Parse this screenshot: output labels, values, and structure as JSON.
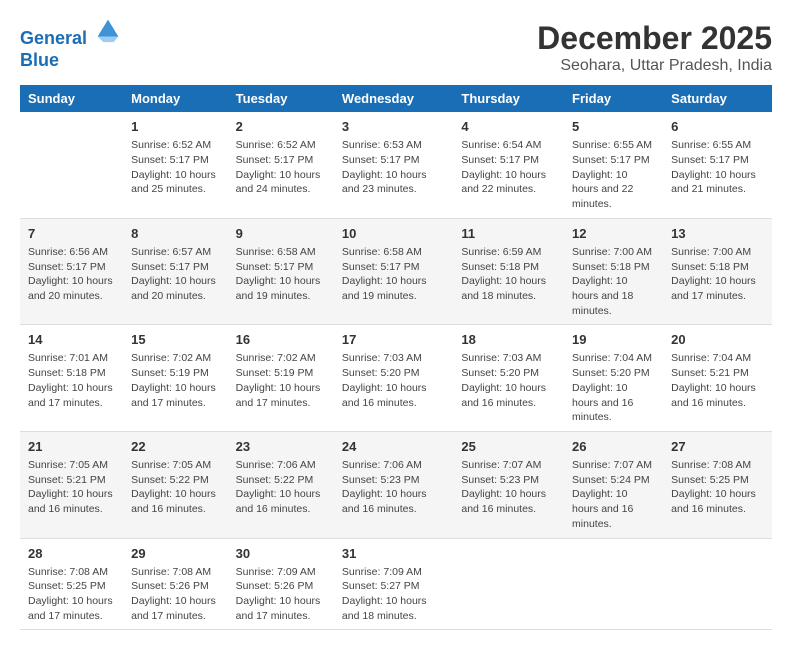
{
  "logo": {
    "line1": "General",
    "line2": "Blue"
  },
  "title": "December 2025",
  "subtitle": "Seohara, Uttar Pradesh, India",
  "headers": [
    "Sunday",
    "Monday",
    "Tuesday",
    "Wednesday",
    "Thursday",
    "Friday",
    "Saturday"
  ],
  "weeks": [
    [
      {
        "day": "",
        "sunrise": "",
        "sunset": "",
        "daylight": ""
      },
      {
        "day": "1",
        "sunrise": "Sunrise: 6:52 AM",
        "sunset": "Sunset: 5:17 PM",
        "daylight": "Daylight: 10 hours and 25 minutes."
      },
      {
        "day": "2",
        "sunrise": "Sunrise: 6:52 AM",
        "sunset": "Sunset: 5:17 PM",
        "daylight": "Daylight: 10 hours and 24 minutes."
      },
      {
        "day": "3",
        "sunrise": "Sunrise: 6:53 AM",
        "sunset": "Sunset: 5:17 PM",
        "daylight": "Daylight: 10 hours and 23 minutes."
      },
      {
        "day": "4",
        "sunrise": "Sunrise: 6:54 AM",
        "sunset": "Sunset: 5:17 PM",
        "daylight": "Daylight: 10 hours and 22 minutes."
      },
      {
        "day": "5",
        "sunrise": "Sunrise: 6:55 AM",
        "sunset": "Sunset: 5:17 PM",
        "daylight": "Daylight: 10 hours and 22 minutes."
      },
      {
        "day": "6",
        "sunrise": "Sunrise: 6:55 AM",
        "sunset": "Sunset: 5:17 PM",
        "daylight": "Daylight: 10 hours and 21 minutes."
      }
    ],
    [
      {
        "day": "7",
        "sunrise": "Sunrise: 6:56 AM",
        "sunset": "Sunset: 5:17 PM",
        "daylight": "Daylight: 10 hours and 20 minutes."
      },
      {
        "day": "8",
        "sunrise": "Sunrise: 6:57 AM",
        "sunset": "Sunset: 5:17 PM",
        "daylight": "Daylight: 10 hours and 20 minutes."
      },
      {
        "day": "9",
        "sunrise": "Sunrise: 6:58 AM",
        "sunset": "Sunset: 5:17 PM",
        "daylight": "Daylight: 10 hours and 19 minutes."
      },
      {
        "day": "10",
        "sunrise": "Sunrise: 6:58 AM",
        "sunset": "Sunset: 5:17 PM",
        "daylight": "Daylight: 10 hours and 19 minutes."
      },
      {
        "day": "11",
        "sunrise": "Sunrise: 6:59 AM",
        "sunset": "Sunset: 5:18 PM",
        "daylight": "Daylight: 10 hours and 18 minutes."
      },
      {
        "day": "12",
        "sunrise": "Sunrise: 7:00 AM",
        "sunset": "Sunset: 5:18 PM",
        "daylight": "Daylight: 10 hours and 18 minutes."
      },
      {
        "day": "13",
        "sunrise": "Sunrise: 7:00 AM",
        "sunset": "Sunset: 5:18 PM",
        "daylight": "Daylight: 10 hours and 17 minutes."
      }
    ],
    [
      {
        "day": "14",
        "sunrise": "Sunrise: 7:01 AM",
        "sunset": "Sunset: 5:18 PM",
        "daylight": "Daylight: 10 hours and 17 minutes."
      },
      {
        "day": "15",
        "sunrise": "Sunrise: 7:02 AM",
        "sunset": "Sunset: 5:19 PM",
        "daylight": "Daylight: 10 hours and 17 minutes."
      },
      {
        "day": "16",
        "sunrise": "Sunrise: 7:02 AM",
        "sunset": "Sunset: 5:19 PM",
        "daylight": "Daylight: 10 hours and 17 minutes."
      },
      {
        "day": "17",
        "sunrise": "Sunrise: 7:03 AM",
        "sunset": "Sunset: 5:20 PM",
        "daylight": "Daylight: 10 hours and 16 minutes."
      },
      {
        "day": "18",
        "sunrise": "Sunrise: 7:03 AM",
        "sunset": "Sunset: 5:20 PM",
        "daylight": "Daylight: 10 hours and 16 minutes."
      },
      {
        "day": "19",
        "sunrise": "Sunrise: 7:04 AM",
        "sunset": "Sunset: 5:20 PM",
        "daylight": "Daylight: 10 hours and 16 minutes."
      },
      {
        "day": "20",
        "sunrise": "Sunrise: 7:04 AM",
        "sunset": "Sunset: 5:21 PM",
        "daylight": "Daylight: 10 hours and 16 minutes."
      }
    ],
    [
      {
        "day": "21",
        "sunrise": "Sunrise: 7:05 AM",
        "sunset": "Sunset: 5:21 PM",
        "daylight": "Daylight: 10 hours and 16 minutes."
      },
      {
        "day": "22",
        "sunrise": "Sunrise: 7:05 AM",
        "sunset": "Sunset: 5:22 PM",
        "daylight": "Daylight: 10 hours and 16 minutes."
      },
      {
        "day": "23",
        "sunrise": "Sunrise: 7:06 AM",
        "sunset": "Sunset: 5:22 PM",
        "daylight": "Daylight: 10 hours and 16 minutes."
      },
      {
        "day": "24",
        "sunrise": "Sunrise: 7:06 AM",
        "sunset": "Sunset: 5:23 PM",
        "daylight": "Daylight: 10 hours and 16 minutes."
      },
      {
        "day": "25",
        "sunrise": "Sunrise: 7:07 AM",
        "sunset": "Sunset: 5:23 PM",
        "daylight": "Daylight: 10 hours and 16 minutes."
      },
      {
        "day": "26",
        "sunrise": "Sunrise: 7:07 AM",
        "sunset": "Sunset: 5:24 PM",
        "daylight": "Daylight: 10 hours and 16 minutes."
      },
      {
        "day": "27",
        "sunrise": "Sunrise: 7:08 AM",
        "sunset": "Sunset: 5:25 PM",
        "daylight": "Daylight: 10 hours and 16 minutes."
      }
    ],
    [
      {
        "day": "28",
        "sunrise": "Sunrise: 7:08 AM",
        "sunset": "Sunset: 5:25 PM",
        "daylight": "Daylight: 10 hours and 17 minutes."
      },
      {
        "day": "29",
        "sunrise": "Sunrise: 7:08 AM",
        "sunset": "Sunset: 5:26 PM",
        "daylight": "Daylight: 10 hours and 17 minutes."
      },
      {
        "day": "30",
        "sunrise": "Sunrise: 7:09 AM",
        "sunset": "Sunset: 5:26 PM",
        "daylight": "Daylight: 10 hours and 17 minutes."
      },
      {
        "day": "31",
        "sunrise": "Sunrise: 7:09 AM",
        "sunset": "Sunset: 5:27 PM",
        "daylight": "Daylight: 10 hours and 18 minutes."
      },
      {
        "day": "",
        "sunrise": "",
        "sunset": "",
        "daylight": ""
      },
      {
        "day": "",
        "sunrise": "",
        "sunset": "",
        "daylight": ""
      },
      {
        "day": "",
        "sunrise": "",
        "sunset": "",
        "daylight": ""
      }
    ]
  ]
}
